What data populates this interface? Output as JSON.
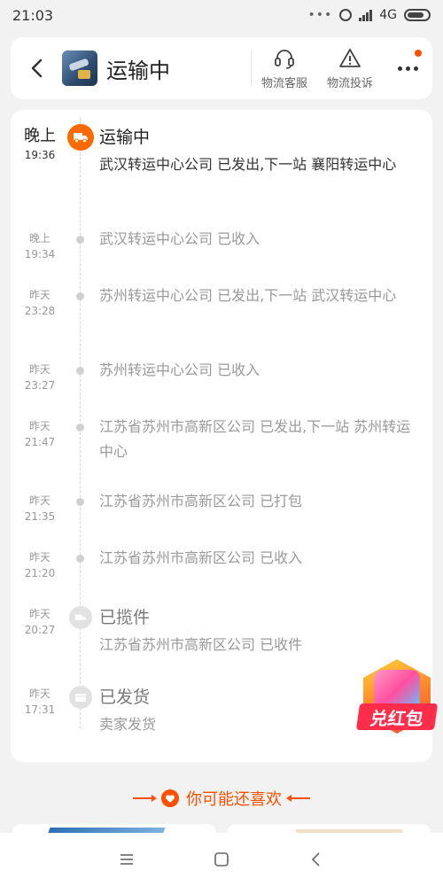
{
  "status_bar": {
    "time": "21:03",
    "dots": "•••",
    "network": "4G"
  },
  "header": {
    "title": "运输中",
    "action_service": "物流客服",
    "action_complaint": "物流投诉",
    "icon_back": "back-arrow-icon",
    "icon_service": "headset-icon",
    "icon_complaint": "warning-triangle-icon",
    "icon_more": "more-dots-icon"
  },
  "timeline": {
    "current": {
      "day": "晚上",
      "time": "19:36",
      "status": "运输中",
      "text": "武汉转运中心公司 已发出,下一站 襄阳转运中心"
    },
    "events": [
      {
        "day": "晚上",
        "time": "19:34",
        "text": "武汉转运中心公司 已收入"
      },
      {
        "day": "昨天",
        "time": "23:28",
        "text": "苏州转运中心公司 已发出,下一站 武汉转运中心"
      },
      {
        "day": "昨天",
        "time": "23:27",
        "text": "苏州转运中心公司 已收入"
      },
      {
        "day": "昨天",
        "time": "21:47",
        "text": "江苏省苏州市高新区公司 已发出,下一站 苏州转运中心"
      },
      {
        "day": "昨天",
        "time": "21:35",
        "text": "江苏省苏州市高新区公司 已打包"
      },
      {
        "day": "昨天",
        "time": "21:20",
        "text": "江苏省苏州市高新区公司 已收入"
      }
    ],
    "pickup": {
      "day": "昨天",
      "time": "20:27",
      "status": "已揽件",
      "text": "江苏省苏州市高新区公司 已收件"
    },
    "shipped": {
      "day": "昨天",
      "time": "17:31",
      "status": "已发货",
      "text": "卖家发货"
    }
  },
  "recommend": {
    "title": "你可能还喜欢"
  },
  "red_pack": {
    "label": "兑红包"
  },
  "colors": {
    "accent": "#ff5000",
    "truck": "#ff6a00"
  }
}
